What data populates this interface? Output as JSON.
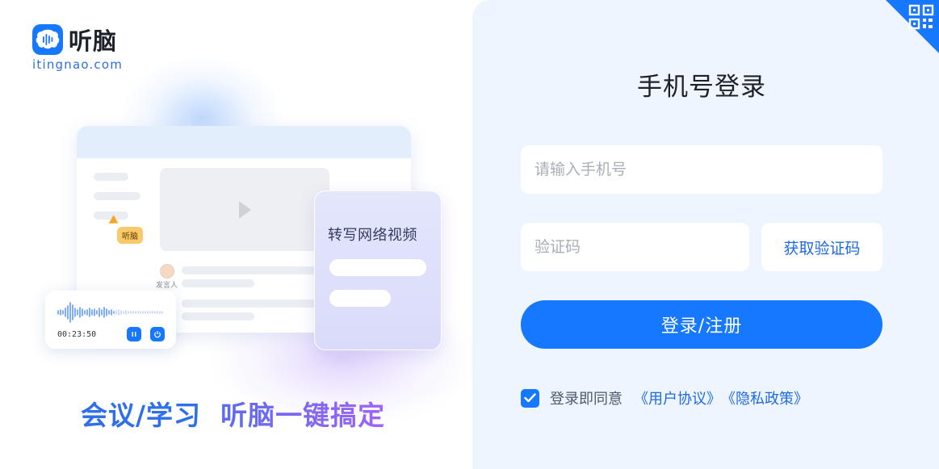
{
  "brand": {
    "name": "听脑",
    "url": "itingnao.com",
    "color": "#1677ff"
  },
  "illustration": {
    "tag_label": "听脑",
    "speaker_label": "发言人",
    "player_time": "00:23:50",
    "card_title": "转写网络视频"
  },
  "slogan": {
    "part1": "会议/学习",
    "part2": "听脑一键搞定"
  },
  "login": {
    "title": "手机号登录",
    "phone_placeholder": "请输入手机号",
    "code_placeholder": "验证码",
    "get_code_label": "获取验证码",
    "submit_label": "登录/注册",
    "agree_text": "登录即同意",
    "user_agreement": "《用户协议》",
    "privacy_policy": "《隐私政策》",
    "agree_checked": true
  },
  "icons": {
    "qr_corner": "qr-code-icon",
    "checkbox": "check-icon",
    "logo": "brain-waveform-icon"
  }
}
